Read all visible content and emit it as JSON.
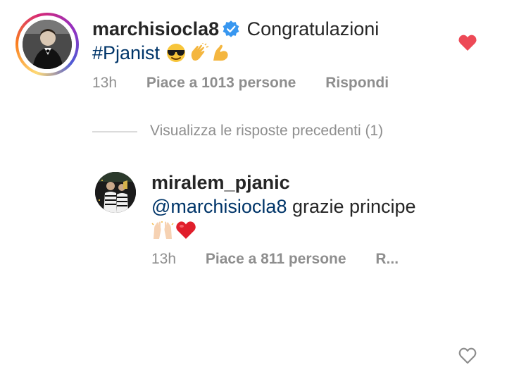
{
  "comment_1": {
    "username": "marchisiocla8",
    "verified": true,
    "text": "Congratulazioni",
    "hashtag": "#Pjanist",
    "emojis": [
      "smiling-face-with-sunglasses",
      "clapping-hands",
      "flexed-biceps"
    ],
    "time": "13h",
    "likes": "Piace a 1013 persone",
    "reply": "Rispondi",
    "liked": true
  },
  "view_previous_replies": "Visualizza le risposte precedenti (1)",
  "comment_2": {
    "username": "miralem_pjanic",
    "mention": "@marchisiocla8",
    "text": "grazie principe",
    "emojis": [
      "raising-hands",
      "red-heart"
    ],
    "time": "13h",
    "likes": "Piace a 811 persone",
    "reply": "R...",
    "liked": false
  },
  "colors": {
    "link": "#003569",
    "meta": "#8e8e8e",
    "like_red": "#ed4956",
    "verified_blue": "#3897f0"
  }
}
